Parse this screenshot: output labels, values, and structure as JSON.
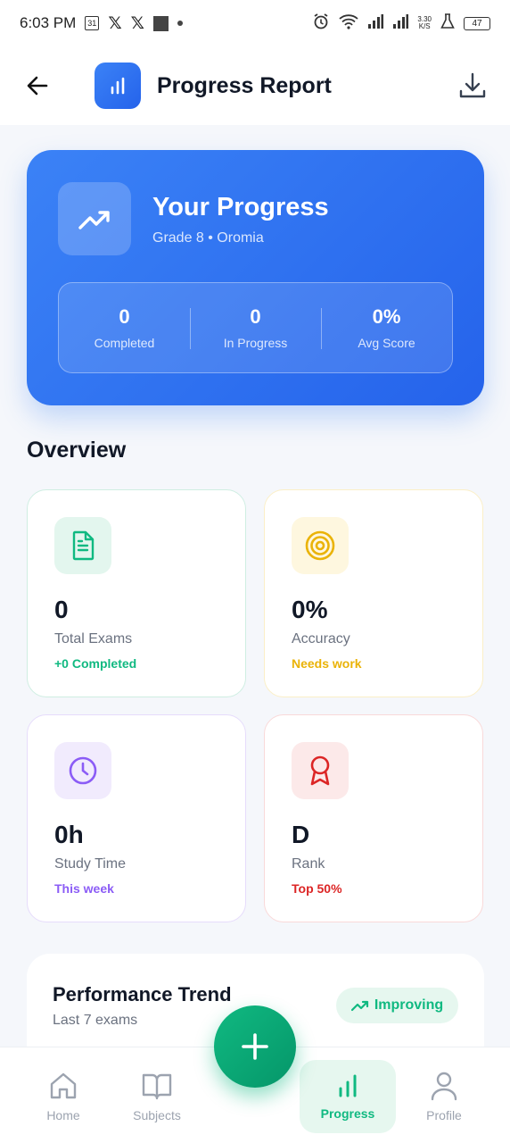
{
  "status_bar": {
    "time": "6:03 PM",
    "calendar_day": "31",
    "network_speed": "3.30",
    "network_unit": "K/S",
    "battery": "47"
  },
  "header": {
    "title": "Progress Report"
  },
  "hero": {
    "title": "Your Progress",
    "subtitle": "Grade 8 • Oromia",
    "stats": [
      {
        "value": "0",
        "label": "Completed"
      },
      {
        "value": "0",
        "label": "In Progress"
      },
      {
        "value": "0%",
        "label": "Avg Score"
      }
    ]
  },
  "overview": {
    "title": "Overview",
    "cards": [
      {
        "value": "0",
        "label": "Total Exams",
        "note": "+0 Completed",
        "icon": "document-icon",
        "accent": "#10b981"
      },
      {
        "value": "0%",
        "label": "Accuracy",
        "note": "Needs work",
        "icon": "target-icon",
        "accent": "#eab308"
      },
      {
        "value": "0h",
        "label": "Study Time",
        "note": "This week",
        "icon": "clock-icon",
        "accent": "#8b5cf6"
      },
      {
        "value": "D",
        "label": "Rank",
        "note": "Top 50%",
        "icon": "award-icon",
        "accent": "#dc2626"
      }
    ]
  },
  "performance": {
    "title": "Performance Trend",
    "subtitle": "Last 7 exams",
    "badge": "Improving"
  },
  "nav": {
    "items": [
      {
        "label": "Home",
        "icon": "home-icon"
      },
      {
        "label": "Subjects",
        "icon": "book-icon"
      },
      {
        "label": "Progress",
        "icon": "bar-chart-icon",
        "active": true
      },
      {
        "label": "Profile",
        "icon": "user-icon"
      }
    ]
  },
  "colors": {
    "primary_blue": "#2563eb",
    "accent_green": "#10b981"
  }
}
